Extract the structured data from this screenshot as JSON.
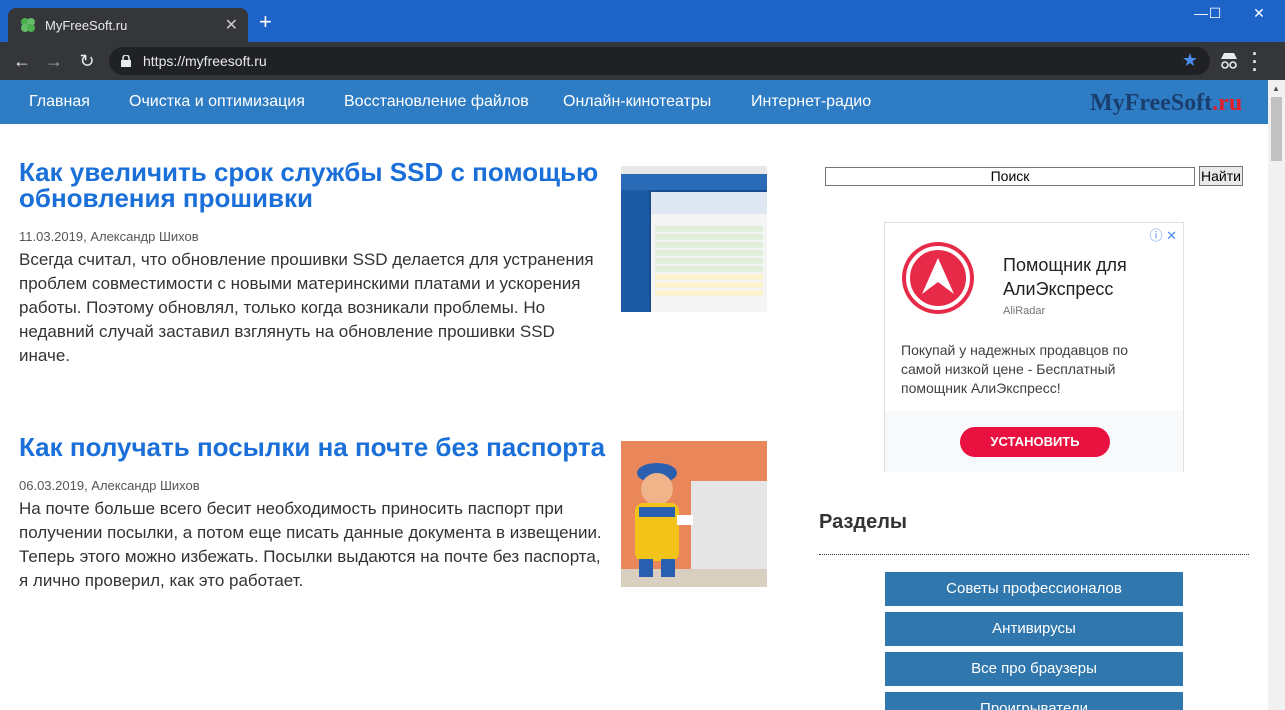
{
  "browser": {
    "tab_title": "MyFreeSoft.ru",
    "tab_close": "✕",
    "new_tab": "+",
    "url": "https://myfreesoft.ru",
    "window_controls": {
      "minimize": "—",
      "maximize": "☐",
      "close": "✕"
    }
  },
  "site": {
    "nav": [
      "Главная",
      "Очистка и оптимизация",
      "Восстановление файлов",
      "Онлайн-кинотеатры",
      "Интернет-радио"
    ],
    "logo_main": "MyFreeSoft",
    "logo_tld": ".ru"
  },
  "articles": [
    {
      "title": "Как увеличить срок службы SSD с помощью обновления прошивки",
      "meta": "11.03.2019, Александр Шихов",
      "excerpt": "Всегда считал, что обновление прошивки SSD делается для устранения проблем совместимости с новыми материнскими платами и ускорения работы. Поэтому обновлял, только когда возникали проблемы. Но недавний случай заставил взглянуть на обновление прошивки SSD иначе."
    },
    {
      "title": "Как получать посылки на почте без паспорта",
      "meta": "06.03.2019, Александр Шихов",
      "excerpt": "На почте больше всего бесит необходимость приносить паспорт при получении посылки, а потом еще писать данные документа в извещении. Теперь этого можно избежать. Посылки выдаются на почте без паспорта, я лично проверил, как это работает."
    }
  ],
  "sidebar": {
    "search_placeholder": "Поиск",
    "search_button": "Найти",
    "ad": {
      "headline": "Помощник для АлиЭкспресс",
      "advertiser": "AliRadar",
      "description": "Покупай у надежных продавцов по самой низкой цене - Бесплатный помощник АлиЭкспресс!",
      "cta": "УСТАНОВИТЬ",
      "badge": "ⓘ ✕"
    },
    "sections_title": "Разделы",
    "sections": [
      "Советы профессионалов",
      "Антивирусы",
      "Все про браузеры",
      "Проигрыватели"
    ]
  },
  "colors": {
    "nav_bg": "#2d7cc4",
    "link": "#1a6fd8",
    "section_btn": "#2f77ad",
    "ad_accent": "#e8113f"
  }
}
